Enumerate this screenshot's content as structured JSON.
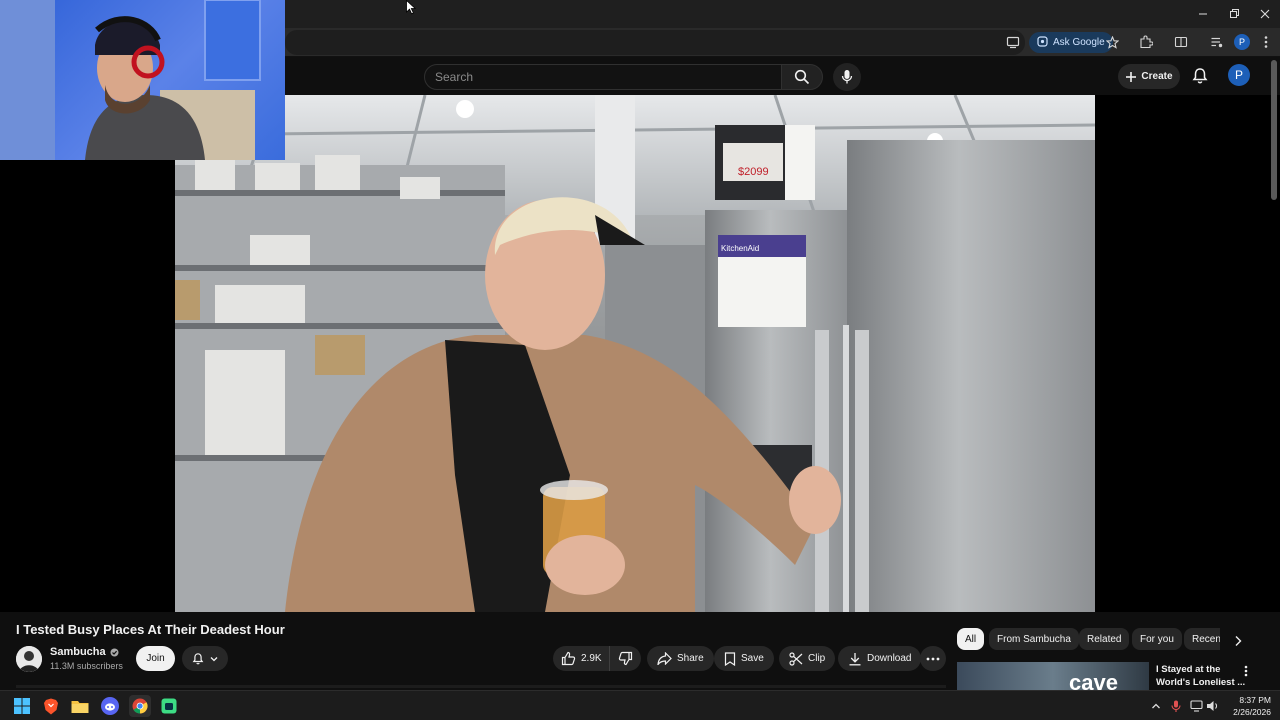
{
  "browser": {
    "ask_google_label": "Ask Google",
    "profile_initial": "P"
  },
  "youtube": {
    "search_placeholder": "Search",
    "create_label": "Create",
    "avatar_initial": "P"
  },
  "video": {
    "title": "I Tested Busy Places At Their Deadest Hour",
    "channel_name": "Sambucha",
    "subscribers": "11.3M subscribers",
    "join_label": "Join",
    "like_count": "2.9K",
    "share_label": "Share",
    "save_label": "Save",
    "clip_label": "Clip",
    "download_label": "Download",
    "scene": {
      "price_tag": "$2099",
      "brand_sign": "KitchenAid"
    }
  },
  "recommendations": {
    "chips": [
      "All",
      "From Sambucha",
      "Related",
      "For you",
      "Recen"
    ],
    "first_item_title_line1": "I Stayed at the",
    "first_item_title_line2": "World's Loneliest ...",
    "first_item_thumb_text": "cave"
  },
  "taskbar": {
    "time": "8:37 PM",
    "date": "2/26/2026"
  },
  "colors": {
    "background": "#0f0f0f",
    "accent_blue": "#1d5fb8",
    "pill": "#272727"
  }
}
